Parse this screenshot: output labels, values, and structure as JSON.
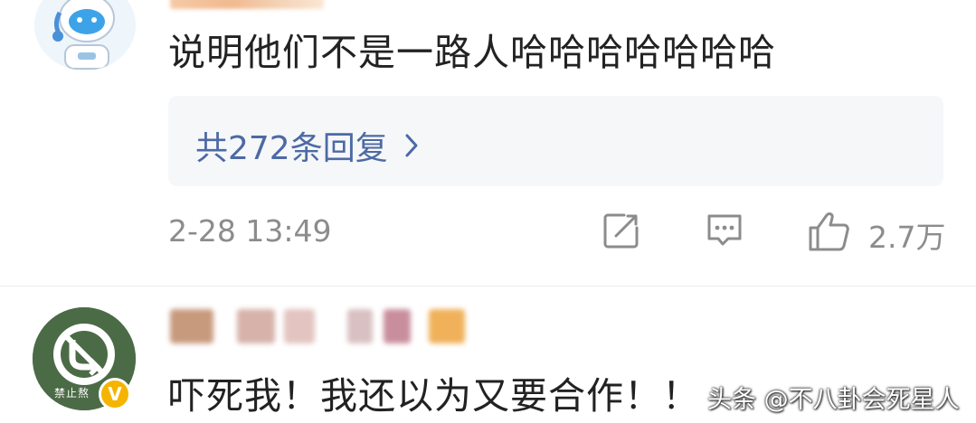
{
  "comments": [
    {
      "text": "说明他们不是一路人哈哈哈哈哈哈哈",
      "reply_link": "共272条回复",
      "timestamp": "2-28 13:49",
      "likes": "2.7万"
    },
    {
      "text": "吓死我！我还以为又要合作！！",
      "avatar_text": "禁止熬"
    }
  ],
  "watermark": "头条 @不八卦会死星人",
  "icons": {
    "chevron": "chevron-right-icon",
    "share": "share-edit-icon",
    "comment": "comment-icon",
    "like": "thumbs-up-icon",
    "verified": "verified-badge-icon"
  },
  "colors": {
    "link": "#4c6aa4",
    "meta_gray": "#8c8c8c",
    "text": "#222222",
    "reply_bg": "#f6f7f9",
    "verified": "#f4b400"
  }
}
